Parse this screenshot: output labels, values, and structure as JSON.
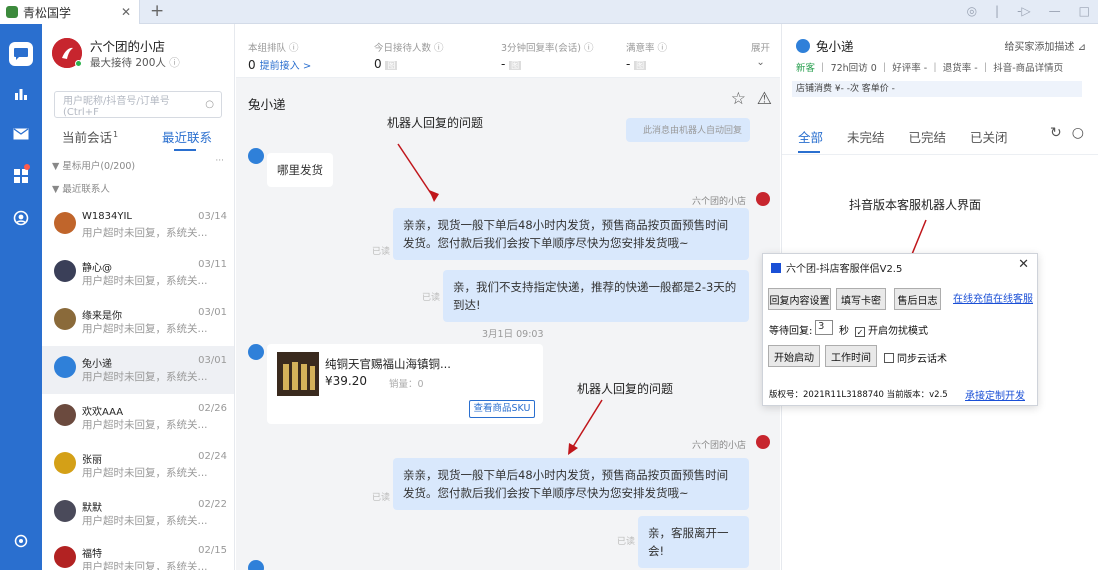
{
  "app": {
    "tab_title": "青松国学",
    "tab_close": "✕",
    "new_tab": "+"
  },
  "window_controls": [
    "◎",
    "|",
    "-▷",
    "—",
    "□"
  ],
  "shop": {
    "name": "六个团的小店",
    "sub": "最大接待 200人",
    "avatar_glyph": "六"
  },
  "search": {
    "placeholder": "用户昵称/抖音号/订单号(Ctrl+F"
  },
  "contact_tabs": {
    "current": "当前会话",
    "current_count": "1",
    "recent": "最近联系"
  },
  "groups": {
    "starred": "▼ 星标用户(0/200)",
    "recent": "▼ 最近联系人",
    "more": "···"
  },
  "contacts": [
    {
      "name": "W1834YIL",
      "date": "03/14",
      "msg": "用户超时未回复，系统关...",
      "color": "#c0652b"
    },
    {
      "name": "静心@",
      "date": "03/11",
      "msg": "用户超时未回复，系统关...",
      "color": "#3a3f58"
    },
    {
      "name": "缘来是你",
      "date": "03/01",
      "msg": "用户超时未回复，系统关...",
      "color": "#8a6a3a"
    },
    {
      "name": "兔小递",
      "date": "03/01",
      "msg": "用户超时未回复，系统关...",
      "color": "#2f80d9"
    },
    {
      "name": "欢欢AAA",
      "date": "02/26",
      "msg": "用户超时未回复，系统关...",
      "color": "#6b4a3e"
    },
    {
      "name": "张丽",
      "date": "02/24",
      "msg": "用户超时未回复，系统关...",
      "color": "#d4a017"
    },
    {
      "name": "默默",
      "date": "02/22",
      "msg": "用户超时未回复，系统关...",
      "color": "#4a4a5a"
    },
    {
      "name": "福特",
      "date": "02/15",
      "msg": "用户超时未回复，系统关...",
      "color": "#b22222"
    }
  ],
  "stats": [
    {
      "label": "本组排队 ⓘ",
      "value": "0",
      "link": "提前接入 >"
    },
    {
      "label": "今日接待人数 ⓘ",
      "value": "0",
      "link": ""
    },
    {
      "label": "3分钟回复率(会话) ⓘ",
      "value": "-",
      "link": ""
    },
    {
      "label": "满意率 ⓘ",
      "value": "-",
      "link": ""
    },
    {
      "label": "展开",
      "value": "⌄",
      "link": ""
    }
  ],
  "chat": {
    "name": "兔小递",
    "robot_note": "此消息由机器人自动回复",
    "customer_msg": "哪里发货",
    "shop_label": "六个团的小店",
    "reply1": "亲亲，现货一般下单后48小时内发货，预售商品按页面预售时间发货。您付款后我们会按下单顺序尽快为您安排发货哦~",
    "reply2": "亲，我们不支持指定快递，推荐的快递一般都是2-3天的到达!",
    "timestamp": "3月1日 09:03",
    "product_title": "纯铜天官赐福山海镇铜...",
    "product_price": "¥39.20",
    "product_sales": "销量：0",
    "product_btn": "查看商品SKU",
    "reply3": "亲亲，现货一般下单后48小时内发货，预售商品按页面预售时间发货。您付款后我们会按下单顺序尽快为您安排发货哦~",
    "reply4": "亲，客服离开一会!",
    "read": "已读",
    "annotation1": "机器人回复的问题",
    "annotation2": "机器人回复的问题"
  },
  "right_panel": {
    "name": "兔小递",
    "add_note": "给买家添加描述 ⊿",
    "info_new": "新客",
    "info_rest": "72h回访 0 ｜ 好评率 - ｜ 退货率 - ｜ 抖音-商品详情页",
    "consume": "店铺消费 ¥- -次   客单价 -",
    "tabs": [
      "全部",
      "未完结",
      "已完结",
      "已关闭"
    ],
    "annotation": "抖音版本客服机器人界面"
  },
  "dialog": {
    "title": "六个团-抖店客服伴侣V2.5",
    "btn_reply": "回复内容设置",
    "btn_card": "填写卡密",
    "btn_log": "售后日志",
    "link_recharge": "在线充值",
    "link_service": "在线客服",
    "wait_label": "等待回复:",
    "wait_value": "3",
    "wait_unit": "秒",
    "dnd_label": "开启勿扰模式",
    "btn_start": "开始启动",
    "btn_worktime": "工作时间",
    "cloud_label": "同步云话术",
    "version_text": "版权号：2021R11L3188740  当前版本：v2.5",
    "link_custom": "承接定制开发"
  },
  "colors": {
    "brand": "#2a6fcf",
    "bubble_out": "#d9e8fc",
    "annotation_arrow": "#c0161b"
  }
}
